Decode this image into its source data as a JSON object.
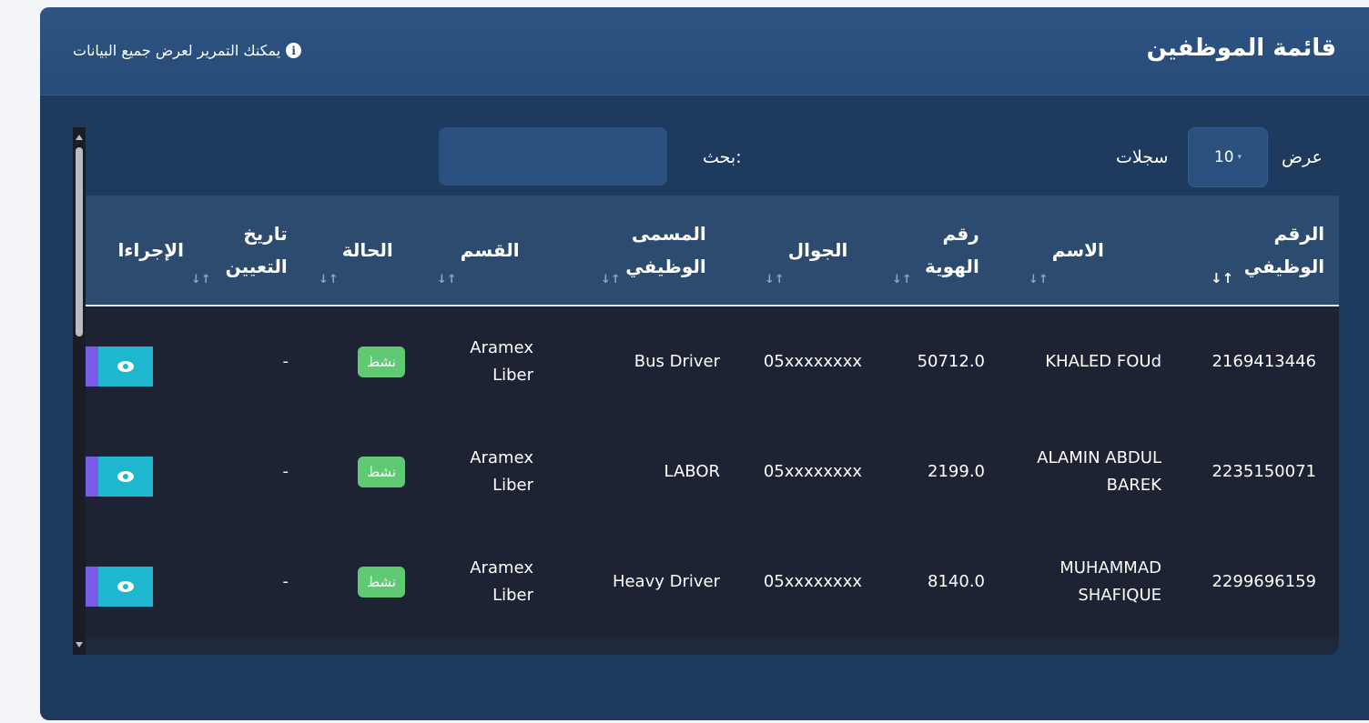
{
  "header": {
    "title": "قائمة الموظفين",
    "hint": "يمكنك التمرير لعرض جميع البيانات",
    "hint_icon": "info-icon"
  },
  "controls": {
    "length_prefix": "عرض",
    "length_value": "10",
    "length_suffix": "سجلات",
    "search_label": "بحث:",
    "search_value": ""
  },
  "table": {
    "columns": [
      {
        "key": "emp_no",
        "label": "الرقم الوظيفي",
        "sort": "asc"
      },
      {
        "key": "name",
        "label": "الاسم",
        "sort": "none"
      },
      {
        "key": "id_no",
        "label": "رقم الهوية",
        "sort": "none"
      },
      {
        "key": "mobile",
        "label": "الجوال",
        "sort": "none"
      },
      {
        "key": "job_title",
        "label": "المسمى الوظيفي",
        "sort": "none"
      },
      {
        "key": "department",
        "label": "القسم",
        "sort": "none"
      },
      {
        "key": "status",
        "label": "الحالة",
        "sort": "none"
      },
      {
        "key": "hire_date",
        "label": "تاريخ التعيين",
        "sort": "none"
      },
      {
        "key": "actions",
        "label": "الإجراءا",
        "sort": "none"
      }
    ],
    "rows": [
      {
        "emp_no": "2169413446",
        "name": "KHALED FOUd",
        "id_no": "50712.0",
        "mobile": "05xxxxxxxx",
        "job_title": "Bus Driver",
        "department": "Aramex Liber",
        "status": "نشط",
        "hire_date": "-"
      },
      {
        "emp_no": "2235150071",
        "name": "ALAMIN ABDUL BAREK",
        "id_no": "2199.0",
        "mobile": "05xxxxxxxx",
        "job_title": "LABOR",
        "department": "Aramex Liber",
        "status": "نشط",
        "hire_date": "-"
      },
      {
        "emp_no": "2299696159",
        "name": "MUHAMMAD SHAFIQUE",
        "id_no": "8140.0",
        "mobile": "05xxxxxxxx",
        "job_title": "Heavy Driver",
        "department": "Aramex Liber",
        "status": "نشط",
        "hire_date": "-"
      }
    ]
  },
  "colors": {
    "page_bg": "#f3f5f9",
    "card_bg": "#1f3a5f",
    "header_bg": "#2d5484",
    "thead_bg": "#2d4b6e",
    "row_bg": "#1e2334",
    "status_active": "#5fca73",
    "view_button": "#1fb6cf",
    "action_accent": "#7b5ce6"
  }
}
